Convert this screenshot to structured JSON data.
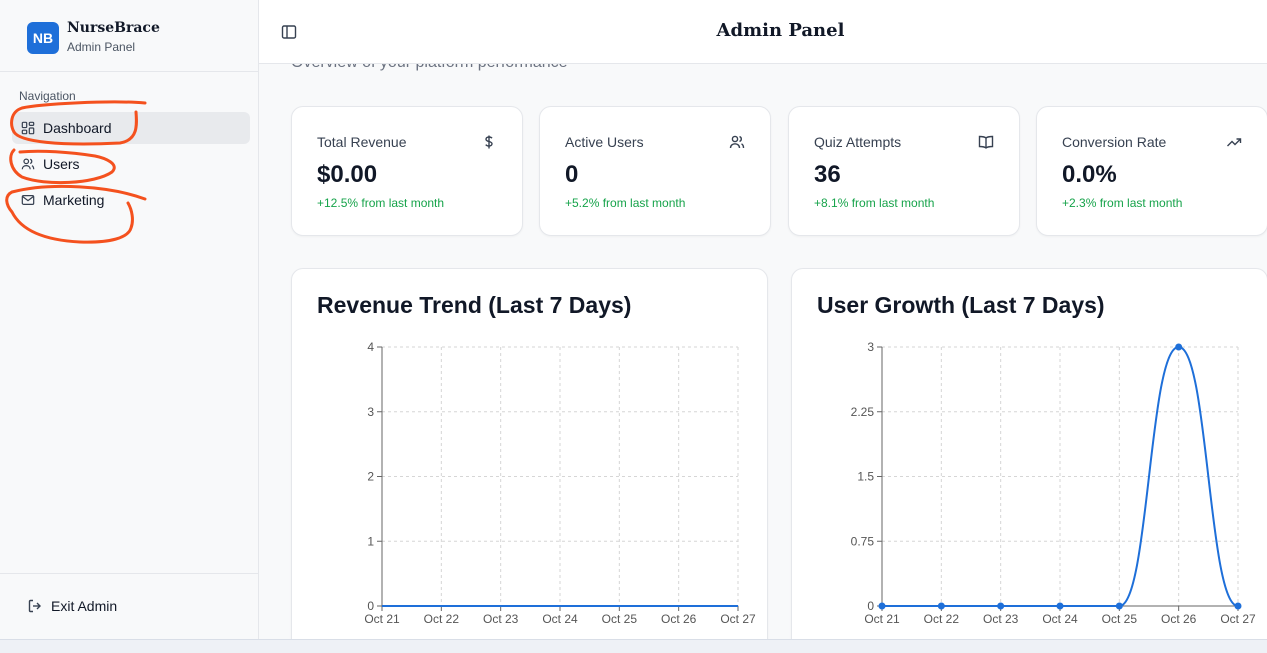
{
  "brand": {
    "initials": "NB",
    "name": "NurseBrace",
    "subtitle": "Admin Panel"
  },
  "sidebar": {
    "heading": "Navigation",
    "items": [
      {
        "label": "Dashboard",
        "icon": "dashboard-icon",
        "active": true
      },
      {
        "label": "Users",
        "icon": "users-icon",
        "active": false
      },
      {
        "label": "Marketing",
        "icon": "mail-icon",
        "active": false
      }
    ],
    "exit_label": "Exit Admin"
  },
  "header": {
    "title": "Admin Panel"
  },
  "main": {
    "subtitle": "Overview of your platform performance",
    "stats": [
      {
        "label": "Total Revenue",
        "value": "$0.00",
        "delta": "+12.5% from last month",
        "icon": "dollar-icon"
      },
      {
        "label": "Active Users",
        "value": "0",
        "delta": "+5.2% from last month",
        "icon": "users-icon"
      },
      {
        "label": "Quiz Attempts",
        "value": "36",
        "delta": "+8.1% from last month",
        "icon": "book-icon"
      },
      {
        "label": "Conversion Rate",
        "value": "0.0%",
        "delta": "+2.3% from last month",
        "icon": "trending-up-icon"
      }
    ]
  },
  "colors": {
    "accent": "#1e6fd9",
    "positive": "#16a34a",
    "line": "#1e6fd9",
    "annotation": "#f4511e"
  },
  "chart_data": [
    {
      "type": "line",
      "title": "Revenue Trend (Last 7 Days)",
      "x": [
        "Oct 21",
        "Oct 22",
        "Oct 23",
        "Oct 24",
        "Oct 25",
        "Oct 26",
        "Oct 27"
      ],
      "series": [
        {
          "values": [
            0,
            0,
            0,
            0,
            0,
            0,
            0
          ]
        }
      ],
      "yticks": [
        "0",
        "1",
        "2",
        "3",
        "4"
      ],
      "ylim": [
        0,
        4
      ],
      "grid": true
    },
    {
      "type": "line",
      "title": "User Growth (Last 7 Days)",
      "x": [
        "Oct 21",
        "Oct 22",
        "Oct 23",
        "Oct 24",
        "Oct 25",
        "Oct 26",
        "Oct 27"
      ],
      "series": [
        {
          "values": [
            0,
            0,
            0,
            0,
            0,
            3,
            0
          ]
        }
      ],
      "yticks": [
        "0",
        "0.75",
        "1.5",
        "2.25",
        "3"
      ],
      "ylim": [
        0,
        3
      ],
      "grid": true
    }
  ]
}
